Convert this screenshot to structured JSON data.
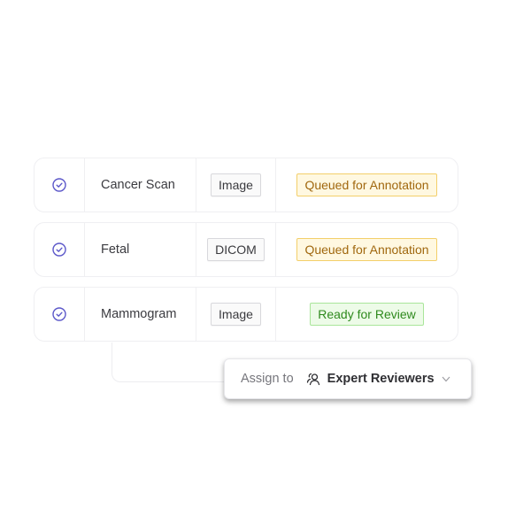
{
  "rows": [
    {
      "name": "Cancer Scan",
      "type": "Image",
      "status": "Queued for Annotation",
      "status_kind": "queued",
      "check_icon": "check-circle-icon"
    },
    {
      "name": "Fetal",
      "type": "DICOM",
      "status": "Queued for Annotation",
      "status_kind": "queued",
      "check_icon": "check-circle-icon"
    },
    {
      "name": "Mammogram",
      "type": "Image",
      "status": "Ready for Review",
      "status_kind": "ready",
      "check_icon": "check-circle-icon"
    }
  ],
  "assign": {
    "label": "Assign to",
    "icon": "people-icon",
    "value": "Expert Reviewers",
    "chevron": "chevron-down-icon"
  },
  "colors": {
    "accent": "#5b57c9",
    "queued_text": "#a0670e",
    "queued_bg": "#fff8e1",
    "ready_text": "#2f8a1e",
    "ready_bg": "#edfbe8"
  }
}
